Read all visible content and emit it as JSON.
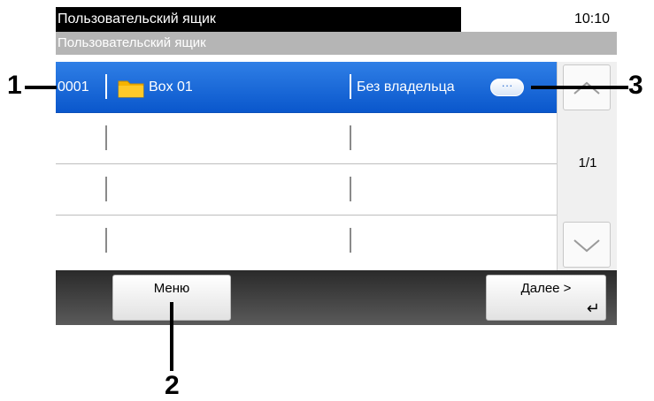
{
  "status_bar": {
    "title": "Пользовательский ящик",
    "time": "10:10"
  },
  "breadcrumb": {
    "text": "Пользовательский ящик"
  },
  "box_list": [
    {
      "number": "0001",
      "name": "Box 01",
      "owner": "Без владельца",
      "selected": true
    },
    {
      "number": "",
      "name": "",
      "owner": "",
      "selected": false
    },
    {
      "number": "",
      "name": "",
      "owner": "",
      "selected": false
    },
    {
      "number": "",
      "name": "",
      "owner": "",
      "selected": false
    }
  ],
  "info_button": {
    "glyph": "···"
  },
  "scrollbar": {
    "page_indicator": "1/1"
  },
  "footer": {
    "menu_label": "Меню",
    "next_label": "Далее >",
    "enter_glyph": "↵"
  },
  "callouts": {
    "c1": "1",
    "c2": "2",
    "c3": "3"
  },
  "colors": {
    "selected_row": "#0a57cc",
    "folder": "#f6b400",
    "bottom_bar": "#333333"
  }
}
